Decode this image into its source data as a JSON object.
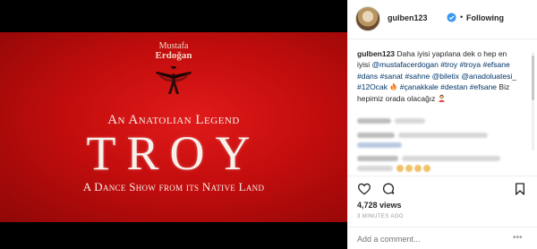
{
  "poster": {
    "brand_first": "Mustafa",
    "brand_last": "Erdoğan",
    "tagline": "An Anatolian Legend",
    "title": "TROY",
    "subtitle": "A Dance Show from its Native Land"
  },
  "header": {
    "username": "gulben123",
    "separator": "•",
    "follow_label": "Following"
  },
  "caption": {
    "username": "gulben123",
    "line1": "Daha iyisi yapılana dek o hep en iyisi",
    "mention1": "@mustafacerdogan",
    "tags1": "#troy #troya #efsane #dans #sanat #sahne",
    "mention2": "@biletix",
    "mention3": "@anadoluatesi_",
    "tag_date": "#12Ocak",
    "tag_place": "#çanakkale",
    "tags2": "#destan #efsane",
    "tail": "Biz hepimiz orada olacağız"
  },
  "stats": {
    "views": "4,728 views",
    "time_ago": "3 MINUTES AGO"
  },
  "comment_box": {
    "placeholder": "Add a comment...",
    "more": "•••"
  },
  "colors": {
    "poster_red": "#c40d0d",
    "link_blue": "#003569",
    "verified_blue": "#3897f0"
  },
  "icons": [
    "dancer-logo",
    "verified-badge-icon",
    "heart-icon",
    "comment-icon",
    "bookmark-icon",
    "fire-emoji-icon",
    "person-emoji-icon"
  ]
}
